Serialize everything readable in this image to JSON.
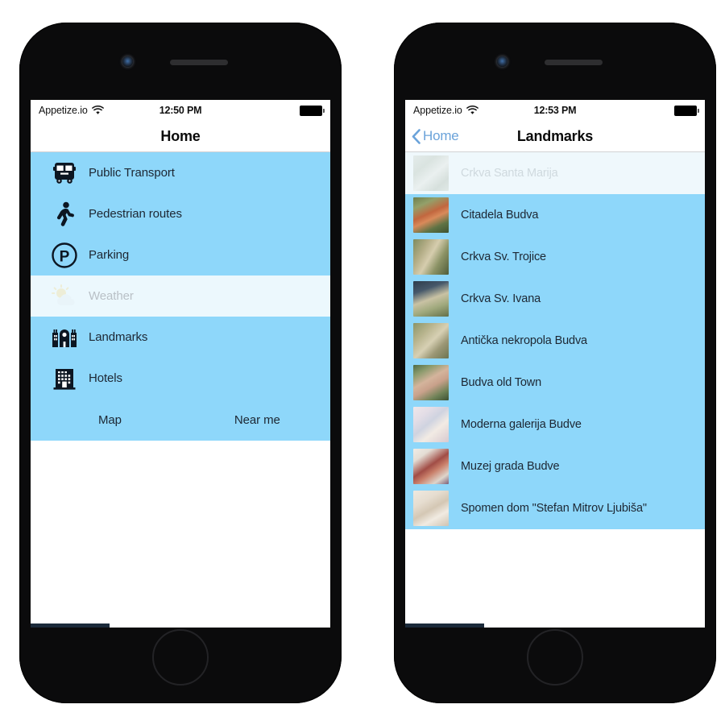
{
  "phones": [
    {
      "id": "home-screen",
      "status_bar": {
        "carrier": "Appetize.io",
        "wifi_icon": "wifi-icon",
        "time": "12:50 PM",
        "battery_icon": "battery-icon"
      },
      "nav": {
        "title": "Home",
        "back_label": null
      },
      "menu_items": [
        {
          "label": "Public Transport",
          "icon": "bus-icon",
          "selected": false
        },
        {
          "label": "Pedestrian routes",
          "icon": "walking-person-icon",
          "selected": false
        },
        {
          "label": "Parking",
          "icon": "parking-p-icon",
          "selected": false
        },
        {
          "label": "Weather",
          "icon": "sun-cloud-icon",
          "selected": true
        },
        {
          "label": "Landmarks",
          "icon": "monument-icon",
          "selected": false
        },
        {
          "label": "Hotels",
          "icon": "hotel-building-icon",
          "selected": false
        }
      ],
      "actions": [
        {
          "label": "Map"
        },
        {
          "label": "Near me"
        }
      ]
    },
    {
      "id": "landmarks-screen",
      "status_bar": {
        "carrier": "Appetize.io",
        "wifi_icon": "wifi-icon",
        "time": "12:53 PM",
        "battery_icon": "battery-icon"
      },
      "nav": {
        "title": "Landmarks",
        "back_label": "Home"
      },
      "landmarks": [
        {
          "label": "Crkva Santa Marija",
          "selected": true,
          "thumb": "aerial-stone-church"
        },
        {
          "label": "Citadela Budva",
          "selected": false,
          "thumb": "aerial-terracotta-roof"
        },
        {
          "label": "Crkva Sv. Trojice",
          "selected": false,
          "thumb": "aerial-town-green"
        },
        {
          "label": "Crkva Sv. Ivana",
          "selected": false,
          "thumb": "aerial-church-dark-roof"
        },
        {
          "label": "Antička nekropola Budva",
          "selected": false,
          "thumb": "aerial-excavation-site"
        },
        {
          "label": "Budva old Town",
          "selected": false,
          "thumb": "aerial-old-town"
        },
        {
          "label": "Moderna galerija Budve",
          "selected": false,
          "thumb": "gallery-interior-white"
        },
        {
          "label": "Muzej grada Budve",
          "selected": false,
          "thumb": "museum-interior-red"
        },
        {
          "label": "Spomen dom \"Stefan Mitrov Ljubiša\"",
          "selected": false,
          "thumb": "memorial-hall-interior"
        }
      ]
    }
  ],
  "colors": {
    "list_blue": "#8ed7fa",
    "selected_row": "#ecf8fd",
    "accent_blue": "#6ba3da",
    "text_dark": "#1d2733",
    "bezel": "#0b0b0c"
  }
}
